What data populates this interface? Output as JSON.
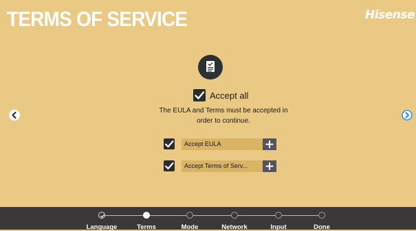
{
  "header": {
    "title": "TERMS OF SERVICE",
    "brand": "Hisense"
  },
  "icons": {
    "document": "document-check-icon",
    "nav_prev": "chevron-left-icon",
    "nav_next": "chevron-right-icon"
  },
  "main": {
    "accept_all": {
      "label": "Accept all",
      "checked": true
    },
    "notice_lines": [
      "The EULA and Terms must be accepted in",
      "order to continue."
    ],
    "items": [
      {
        "label": "Accept EULA",
        "checked": true,
        "action": "+"
      },
      {
        "label": "Accept Terms of Serv...",
        "checked": true,
        "action": "+"
      }
    ]
  },
  "steps": [
    {
      "label": "Language",
      "state": "done"
    },
    {
      "label": "Terms",
      "state": "current"
    },
    {
      "label": "Mode",
      "state": "pending"
    },
    {
      "label": "Network",
      "state": "pending"
    },
    {
      "label": "Input",
      "state": "pending"
    },
    {
      "label": "Done",
      "state": "pending"
    }
  ],
  "colors": {
    "background": "#e9c983",
    "item_background": "#d8b464",
    "bottom_bar": "#3a3838",
    "checkbox": "#2a2d30",
    "accent_next": "#2b8fd6"
  }
}
